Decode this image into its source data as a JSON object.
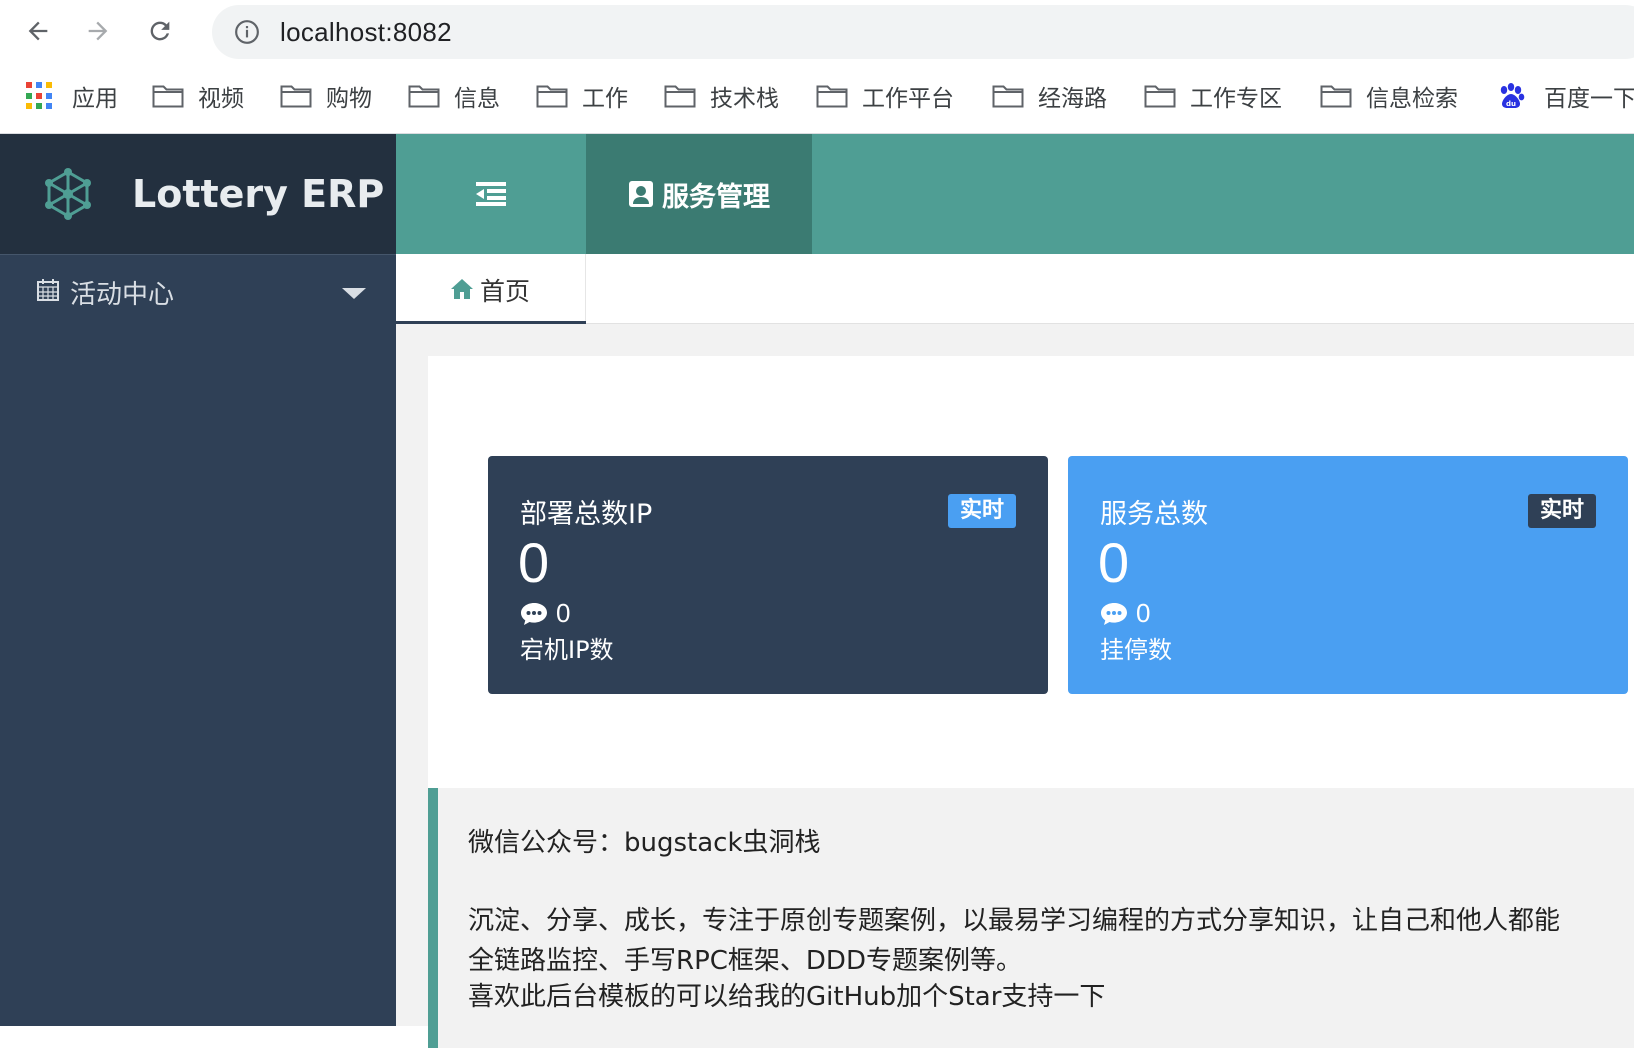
{
  "browser": {
    "url": "localhost:8082",
    "bookmarks": [
      {
        "label": "应用",
        "icon": "apps-grid-icon"
      },
      {
        "label": "视频",
        "icon": "folder-icon"
      },
      {
        "label": "购物",
        "icon": "folder-icon"
      },
      {
        "label": "信息",
        "icon": "folder-icon"
      },
      {
        "label": "工作",
        "icon": "folder-icon"
      },
      {
        "label": "技术栈",
        "icon": "folder-icon"
      },
      {
        "label": "工作平台",
        "icon": "folder-icon"
      },
      {
        "label": "经海路",
        "icon": "folder-icon"
      },
      {
        "label": "工作专区",
        "icon": "folder-icon"
      },
      {
        "label": "信息检索",
        "icon": "folder-icon"
      },
      {
        "label": "百度一下",
        "icon": "baidu-paw-icon"
      }
    ]
  },
  "sidebar": {
    "brand": "Lottery ERP",
    "menu": [
      {
        "label": "活动中心",
        "icon": "calendar-icon",
        "expanded": false
      }
    ]
  },
  "header": {
    "toggle_icon": "menu-collapse-icon",
    "service_label": "服务管理",
    "service_icon": "id-card-icon"
  },
  "tabs": [
    {
      "label": "首页",
      "icon": "home-icon",
      "active": true
    }
  ],
  "cards": [
    {
      "title": "部署总数IP",
      "badge": "实时",
      "value": "0",
      "sub_value": "0",
      "sub_label": "宕机IP数",
      "color": "#2f4056",
      "badge_color": "#4a9ff2"
    },
    {
      "title": "服务总数",
      "badge": "实时",
      "value": "0",
      "sub_value": "0",
      "sub_label": "挂停数",
      "color": "#4a9ff2",
      "badge_color": "#2f4056"
    }
  ],
  "notice": {
    "lines": [
      "微信公众号：bugstack虫洞栈",
      "沉淀、分享、成长，专注于原创专题案例，以最易学习编程的方式分享知识，让自己和他人都能",
      "全链路监控、手写RPC框架、DDD专题案例等。",
      "喜欢此后台模板的可以给我的GitHub加个Star支持一下"
    ]
  },
  "colors": {
    "sidebar_bg": "#2f4056",
    "brand_bg": "#23303f",
    "header_bg": "#4f9e94",
    "header_active_bg": "#3b7b72",
    "accent_blue": "#4a9ff2",
    "content_bg": "#f2f2f2"
  }
}
